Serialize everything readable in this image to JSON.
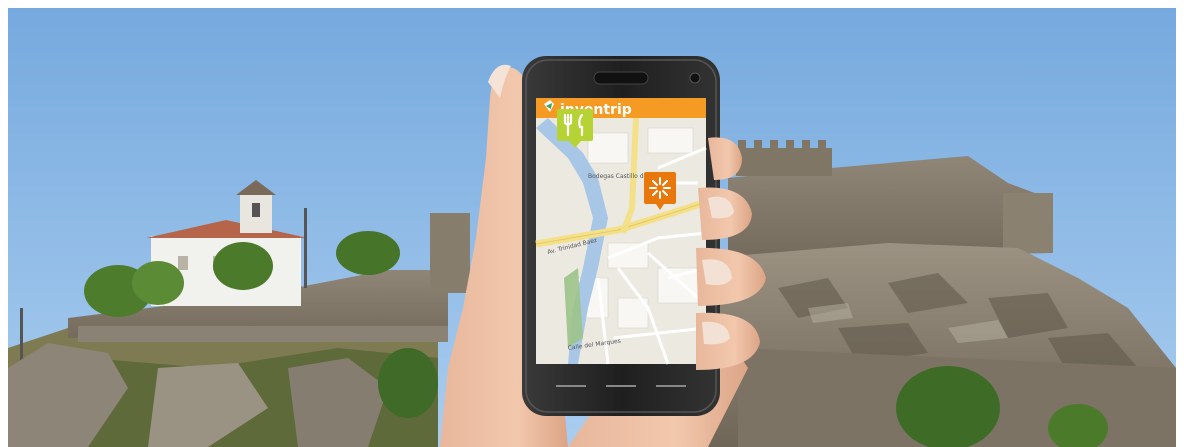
{
  "app": {
    "name": "inventrip",
    "header_color": "#f59a23",
    "pins": [
      {
        "icon": "fork-knife-icon",
        "color": "#b5d334"
      },
      {
        "icon": "sun-logo-icon",
        "color": "#e8780c"
      }
    ]
  },
  "map": {
    "streets": [
      "Av. Trinidad Baez",
      "Calle del Marques",
      "Bodegas Castillo de Pataleo"
    ]
  },
  "colors": {
    "sky": "#8db9e6",
    "rock": "#8a8170",
    "phone_body": "#2b2b2b"
  }
}
